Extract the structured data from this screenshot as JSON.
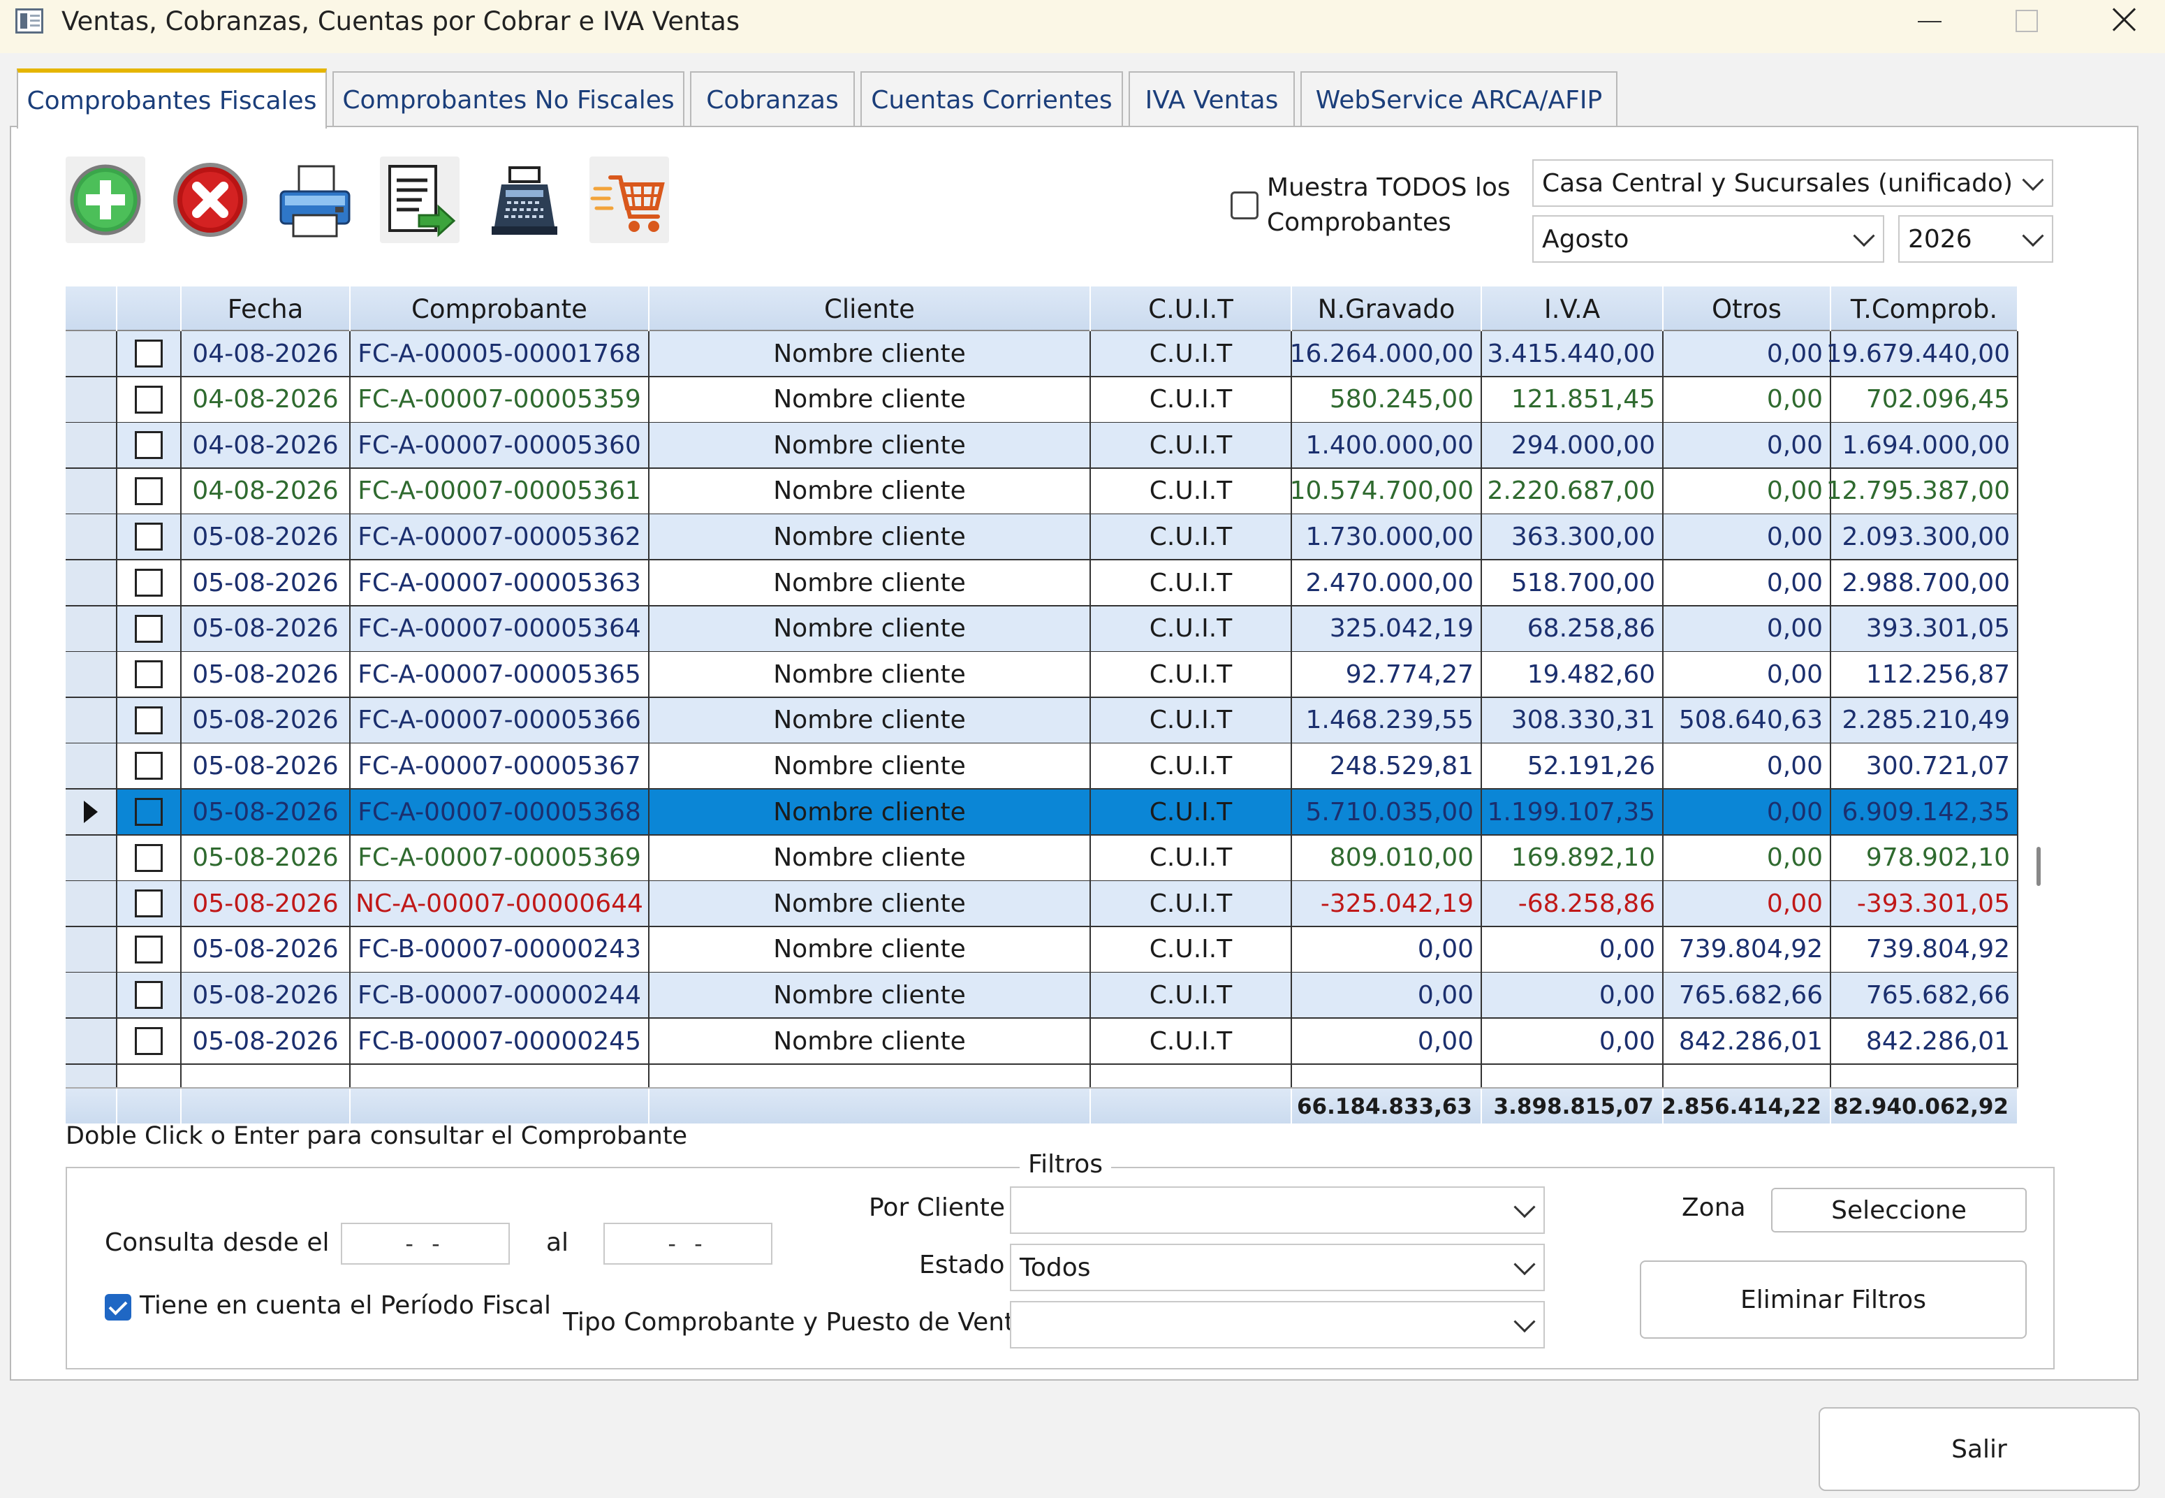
{
  "window": {
    "title": "Ventas, Cobranzas, Cuentas por Cobrar e IVA Ventas"
  },
  "tabs": [
    {
      "label": "Comprobantes Fiscales",
      "active": true
    },
    {
      "label": "Comprobantes No Fiscales"
    },
    {
      "label": "Cobranzas"
    },
    {
      "label": "Cuentas Corrientes"
    },
    {
      "label": "IVA Ventas"
    },
    {
      "label": "WebService ARCA/AFIP"
    }
  ],
  "toolbar": {
    "icons": [
      "add-icon",
      "delete-icon",
      "printer-icon",
      "export-document-icon",
      "cash-register-icon",
      "shopping-cart-icon"
    ]
  },
  "options": {
    "show_all_label": "Muestra TODOS los Comprobantes",
    "show_all_checked": false,
    "branch_value": "Casa Central y Sucursales (unificado)",
    "month_value": "Agosto",
    "year_value": "2026"
  },
  "grid": {
    "columns": [
      "Fecha",
      "Comprobante",
      "Cliente",
      "C.U.I.T",
      "N.Gravado",
      "I.V.A",
      "Otros",
      "T.Comprob."
    ],
    "rows": [
      {
        "fecha": "04-08-2026",
        "comprobante": "FC-A-00005-00001768",
        "cliente": "Nombre cliente",
        "cuit": "C.U.I.T",
        "gravado": "16.264.000,00",
        "iva": "3.415.440,00",
        "otros": "0,00",
        "total": "19.679.440,00",
        "color": "#1b2f6e"
      },
      {
        "fecha": "04-08-2026",
        "comprobante": "FC-A-00007-00005359",
        "cliente": "Nombre cliente",
        "cuit": "C.U.I.T",
        "gravado": "580.245,00",
        "iva": "121.851,45",
        "otros": "0,00",
        "total": "702.096,45",
        "color": "#2f6a2f"
      },
      {
        "fecha": "04-08-2026",
        "comprobante": "FC-A-00007-00005360",
        "cliente": "Nombre cliente",
        "cuit": "C.U.I.T",
        "gravado": "1.400.000,00",
        "iva": "294.000,00",
        "otros": "0,00",
        "total": "1.694.000,00",
        "color": "#1b2f6e"
      },
      {
        "fecha": "04-08-2026",
        "comprobante": "FC-A-00007-00005361",
        "cliente": "Nombre cliente",
        "cuit": "C.U.I.T",
        "gravado": "10.574.700,00",
        "iva": "2.220.687,00",
        "otros": "0,00",
        "total": "12.795.387,00",
        "color": "#2f6a2f"
      },
      {
        "fecha": "05-08-2026",
        "comprobante": "FC-A-00007-00005362",
        "cliente": "Nombre cliente",
        "cuit": "C.U.I.T",
        "gravado": "1.730.000,00",
        "iva": "363.300,00",
        "otros": "0,00",
        "total": "2.093.300,00",
        "color": "#1b2f6e"
      },
      {
        "fecha": "05-08-2026",
        "comprobante": "FC-A-00007-00005363",
        "cliente": "Nombre cliente",
        "cuit": "C.U.I.T",
        "gravado": "2.470.000,00",
        "iva": "518.700,00",
        "otros": "0,00",
        "total": "2.988.700,00",
        "color": "#1b2f6e"
      },
      {
        "fecha": "05-08-2026",
        "comprobante": "FC-A-00007-00005364",
        "cliente": "Nombre cliente",
        "cuit": "C.U.I.T",
        "gravado": "325.042,19",
        "iva": "68.258,86",
        "otros": "0,00",
        "total": "393.301,05",
        "color": "#1b2f6e"
      },
      {
        "fecha": "05-08-2026",
        "comprobante": "FC-A-00007-00005365",
        "cliente": "Nombre cliente",
        "cuit": "C.U.I.T",
        "gravado": "92.774,27",
        "iva": "19.482,60",
        "otros": "0,00",
        "total": "112.256,87",
        "color": "#1b2f6e"
      },
      {
        "fecha": "05-08-2026",
        "comprobante": "FC-A-00007-00005366",
        "cliente": "Nombre cliente",
        "cuit": "C.U.I.T",
        "gravado": "1.468.239,55",
        "iva": "308.330,31",
        "otros": "508.640,63",
        "total": "2.285.210,49",
        "color": "#1b2f6e"
      },
      {
        "fecha": "05-08-2026",
        "comprobante": "FC-A-00007-00005367",
        "cliente": "Nombre cliente",
        "cuit": "C.U.I.T",
        "gravado": "248.529,81",
        "iva": "52.191,26",
        "otros": "0,00",
        "total": "300.721,07",
        "color": "#1b2f6e"
      },
      {
        "fecha": "05-08-2026",
        "comprobante": "FC-A-00007-00005368",
        "cliente": "Nombre cliente",
        "cuit": "C.U.I.T",
        "gravado": "5.710.035,00",
        "iva": "1.199.107,35",
        "otros": "0,00",
        "total": "6.909.142,35",
        "color": "#1b2f6e",
        "selected": true
      },
      {
        "fecha": "05-08-2026",
        "comprobante": "FC-A-00007-00005369",
        "cliente": "Nombre cliente",
        "cuit": "C.U.I.T",
        "gravado": "809.010,00",
        "iva": "169.892,10",
        "otros": "0,00",
        "total": "978.902,10",
        "color": "#2f6a2f"
      },
      {
        "fecha": "05-08-2026",
        "comprobante": "NC-A-00007-00000644",
        "cliente": "Nombre cliente",
        "cuit": "C.U.I.T",
        "gravado": "-325.042,19",
        "iva": "-68.258,86",
        "otros": "0,00",
        "total": "-393.301,05",
        "color": "#c01818"
      },
      {
        "fecha": "05-08-2026",
        "comprobante": "FC-B-00007-00000243",
        "cliente": "Nombre cliente",
        "cuit": "C.U.I.T",
        "gravado": "0,00",
        "iva": "0,00",
        "otros": "739.804,92",
        "total": "739.804,92",
        "color": "#1b2f6e"
      },
      {
        "fecha": "05-08-2026",
        "comprobante": "FC-B-00007-00000244",
        "cliente": "Nombre cliente",
        "cuit": "C.U.I.T",
        "gravado": "0,00",
        "iva": "0,00",
        "otros": "765.682,66",
        "total": "765.682,66",
        "color": "#1b2f6e"
      },
      {
        "fecha": "05-08-2026",
        "comprobante": "FC-B-00007-00000245",
        "cliente": "Nombre cliente",
        "cuit": "C.U.I.T",
        "gravado": "0,00",
        "iva": "0,00",
        "otros": "842.286,01",
        "total": "842.286,01",
        "color": "#1b2f6e"
      }
    ],
    "totals": {
      "gravado": "66.184.833,63",
      "iva": "3.898.815,07",
      "otros": "2.856.414,22",
      "total": "82.940.062,92"
    }
  },
  "hint": "Doble Click o Enter para consultar el Comprobante",
  "filters": {
    "title": "Filtros",
    "desde_label": "Consulta desde el",
    "desde_value": "- -",
    "al_label": "al",
    "al_value": "- -",
    "periodo_label": "Tiene en cuenta el Período Fiscal",
    "periodo_checked": true,
    "cliente_label": "Por Cliente",
    "cliente_value": "",
    "estado_label": "Estado",
    "estado_value": "Todos",
    "tipo_label": "Tipo Comprobante y Puesto de Venta",
    "tipo_value": "",
    "zona_label": "Zona",
    "zona_button": "Seleccione",
    "clear_button": "Eliminar Filtros"
  },
  "exit_button": "Salir"
}
